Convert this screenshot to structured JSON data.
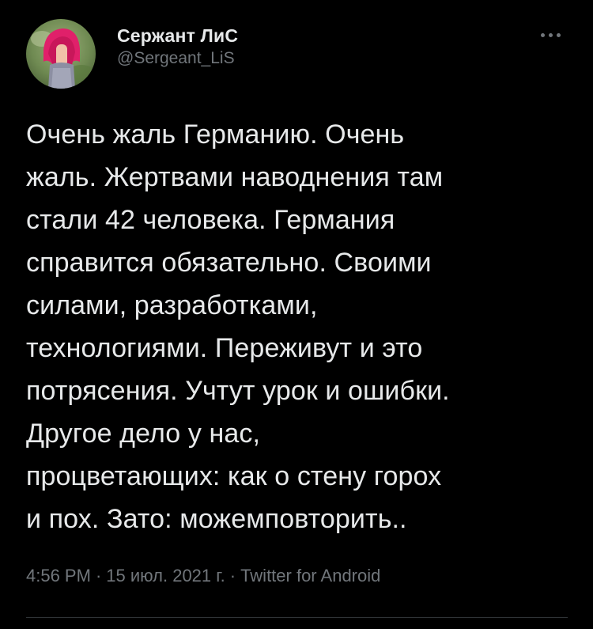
{
  "user": {
    "display_name": "Сержант ЛиС",
    "handle": "@Sergeant_LiS",
    "avatar_icon": "user-avatar-photo"
  },
  "more_icon": "more-horizontal-icon",
  "tweet": {
    "text": "Очень жаль Германию. Очень\nжаль. Жертвами наводнения там\nстали 42 человека. Германия\nсправится обязательно. Своими\nсилами, разработками,\nтехнологиями. Переживут и это\nпотрясения. Учтут урок и ошибки.\nДругое дело у нас,\nпроцветающих: как о стену горох\nи пох. Зато: можемповторить.."
  },
  "meta": {
    "time": "4:56 PM",
    "separator": "·",
    "date": "15 июл. 2021 г.",
    "source": "Twitter for Android"
  },
  "colors": {
    "background": "#000000",
    "text": "#e7e9ea",
    "secondary": "#71767b",
    "divider": "#2f3336"
  }
}
